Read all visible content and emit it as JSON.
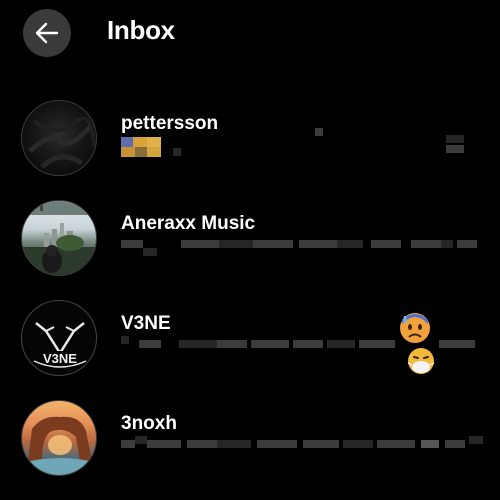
{
  "header": {
    "title": "Inbox",
    "back_icon": "arrow-left-icon"
  },
  "conversations": [
    {
      "name": "pettersson",
      "avatar": "black-fabric-avatar",
      "preview_emoji": "square-tiles-emoji"
    },
    {
      "name": "Aneraxx Music",
      "avatar": "city-skyline-photo-avatar"
    },
    {
      "name": "V3NE",
      "avatar": "v3ne-logo-avatar",
      "preview_emoji": [
        "anxious-sweat-face-emoji",
        "face-with-medical-mask-emoji"
      ]
    },
    {
      "name": "3noxh",
      "avatar": "rock-arch-sunset-avatar"
    }
  ],
  "colors": {
    "background": "#000000",
    "back_button": "#3a3a3a",
    "text": "#ffffff",
    "blurred_preview": "#3c3c3c"
  }
}
